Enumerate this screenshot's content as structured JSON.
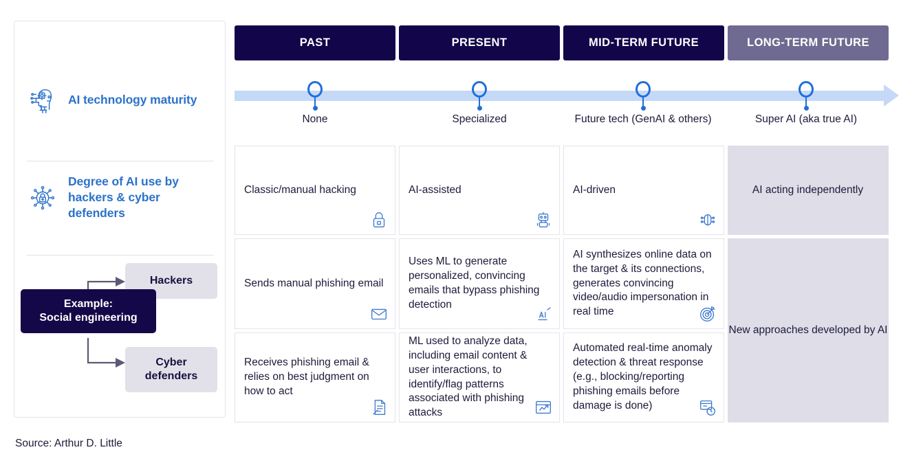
{
  "sidebar": {
    "blocks": [
      {
        "icon": "ai-head-circuit-icon",
        "label": "AI technology maturity"
      },
      {
        "icon": "ai-lock-circuit-icon",
        "label": "Degree of AI use by hackers & cyber defenders"
      }
    ],
    "example": {
      "box_label": "Example:\nSocial engineering",
      "box_line1": "Example:",
      "box_line2": "Social engineering",
      "branches": [
        {
          "label": "Hackers"
        },
        {
          "label": "Cyber defenders"
        }
      ]
    }
  },
  "header": {
    "tabs": [
      {
        "label": "PAST",
        "color": "#12054a"
      },
      {
        "label": "PRESENT",
        "color": "#12054a"
      },
      {
        "label": "MID-TERM FUTURE",
        "color": "#12054a"
      },
      {
        "label": "LONG-TERM FUTURE",
        "color": "#6f6a91"
      }
    ]
  },
  "timeline": {
    "bar_color": "#c5d9f7",
    "marker_color": "#1f6fd8",
    "nodes": [
      {
        "label": "None"
      },
      {
        "label": "Specialized"
      },
      {
        "label": "Future tech (GenAI & others)"
      },
      {
        "label": "Super AI (aka true AI)"
      }
    ]
  },
  "grid": {
    "rows": [
      {
        "name": "degree-of-ai-use",
        "cells": [
          {
            "text": "Classic/manual hacking",
            "icon": "padlock-icon",
            "grey": false
          },
          {
            "text": "AI-assisted",
            "icon": "robot-icon",
            "grey": false
          },
          {
            "text": "AI-driven",
            "icon": "ai-brain-icon",
            "grey": false
          },
          {
            "text": "AI acting independently",
            "icon": "",
            "grey": true
          }
        ]
      },
      {
        "name": "hackers",
        "cells": [
          {
            "text": "Sends manual phishing email",
            "icon": "envelope-icon",
            "grey": false
          },
          {
            "text": "Uses ML to generate personalized, convincing emails that bypass phishing detection",
            "icon": "ai-writing-icon",
            "grey": false
          },
          {
            "text": "AI synthesizes online data on the target & its connections, generates convincing video/audio impersonation in real time",
            "icon": "target-icon",
            "grey": false
          }
        ]
      },
      {
        "name": "cyber-defenders",
        "cells": [
          {
            "text": "Receives phishing email & relies on best judgment on how to act",
            "icon": "document-review-icon",
            "grey": false
          },
          {
            "text": "ML used to analyze data, including email content & user interactions, to identify/flag patterns associated with phishing attacks",
            "icon": "data-analysis-icon",
            "grey": false
          },
          {
            "text": "Automated real-time anomaly detection & threat response (e.g., blocking/reporting phishing emails before damage is done)",
            "icon": "automated-response-icon",
            "grey": false
          }
        ]
      }
    ],
    "merged_cell": {
      "text": "New approaches developed by AI",
      "grey": true
    }
  },
  "footer": {
    "source": "Source: Arthur D. Little"
  }
}
